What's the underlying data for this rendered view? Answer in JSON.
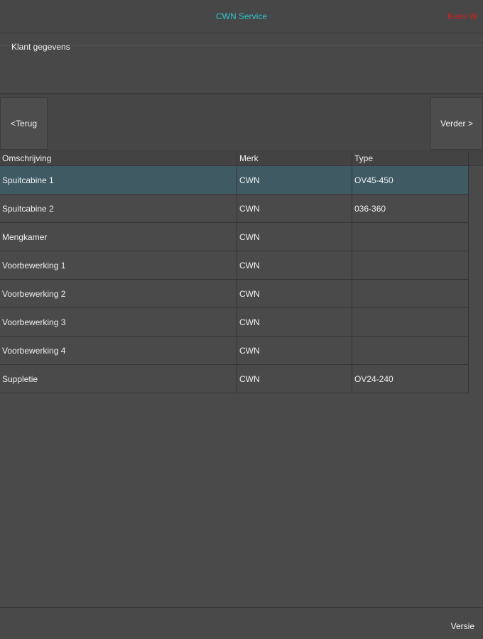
{
  "header": {
    "title": "CWN Service",
    "user": "Kees W",
    "title_color": "#2ec7d3",
    "user_color": "#d02020"
  },
  "customer_panel": {
    "label": "Klant gegevens"
  },
  "navigation": {
    "back_label": "<Terug",
    "next_label": "Verder >"
  },
  "table": {
    "columns": [
      "Omschrijving",
      "Merk",
      "Type"
    ],
    "selected_row": 0,
    "selected_color": "#3f5a63",
    "rows": [
      {
        "omschrijving": "Spuitcabine 1",
        "merk": "CWN",
        "type": "OV45-450"
      },
      {
        "omschrijving": "Spuitcabine 2",
        "merk": "CWN",
        "type": "036-360"
      },
      {
        "omschrijving": "Mengkamer",
        "merk": "CWN",
        "type": ""
      },
      {
        "omschrijving": "Voorbewerking 1",
        "merk": "CWN",
        "type": ""
      },
      {
        "omschrijving": "Voorbewerking 2",
        "merk": "CWN",
        "type": ""
      },
      {
        "omschrijving": "Voorbewerking 3",
        "merk": "CWN",
        "type": ""
      },
      {
        "omschrijving": "Voorbewerking 4",
        "merk": "CWN",
        "type": ""
      },
      {
        "omschrijving": "Suppletie",
        "merk": "CWN",
        "type": "OV24-240"
      }
    ]
  },
  "footer": {
    "version_label": "Versie"
  }
}
